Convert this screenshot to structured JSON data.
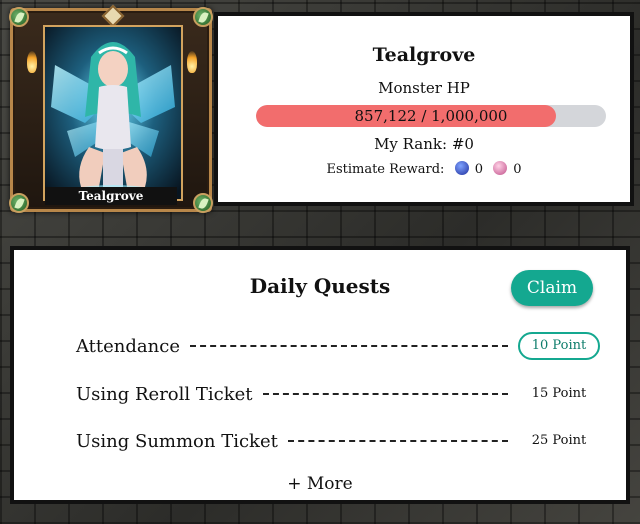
{
  "boss": {
    "card_name": "Tealgrove",
    "name": "Tealgrove",
    "hp_label": "Monster HP",
    "hp_text": "857,122 / 1,000,000",
    "hp_fraction": 0.857,
    "rank_text": "My Rank: #0",
    "reward_label": "Estimate Reward:",
    "reward_coin_value": "0",
    "reward_gem_value": "0",
    "icons": {
      "coin": "blue-coin-icon",
      "gem": "pink-gem-icon",
      "corners": "leaf-emblem-icon"
    }
  },
  "quests": {
    "title": "Daily Quests",
    "claim_label": "Claim",
    "items": [
      {
        "name": "Attendance",
        "points": "10 Point",
        "claimable": true
      },
      {
        "name": "Using Reroll Ticket",
        "points": "15 Point",
        "claimable": false
      },
      {
        "name": "Using Summon Ticket",
        "points": "25 Point",
        "claimable": false
      }
    ],
    "more_label": "+ More"
  },
  "colors": {
    "hp_fill": "#f26d6d",
    "hp_track": "#d4d6da",
    "accent": "#14a890",
    "frame": "#b8874a"
  }
}
